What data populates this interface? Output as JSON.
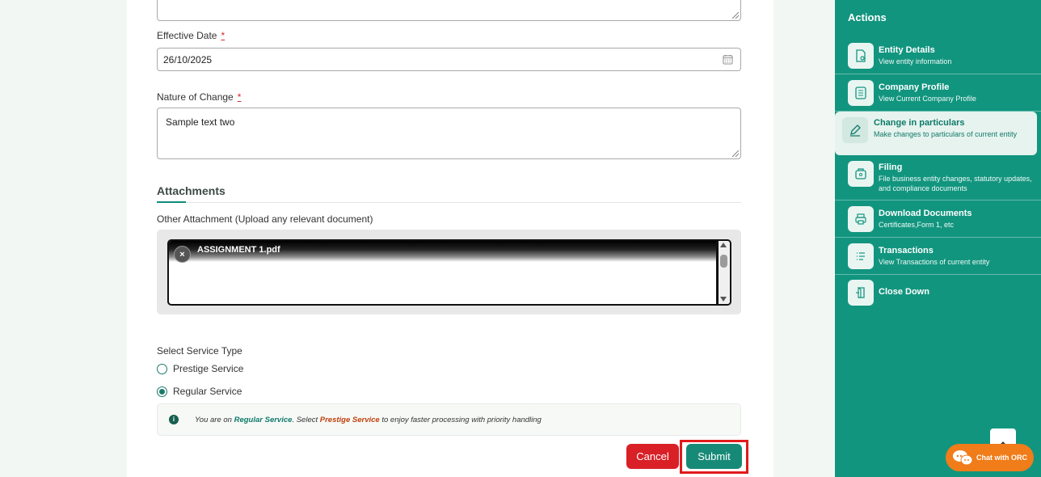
{
  "form": {
    "effective_date": {
      "label": "Effective Date",
      "required_mark": "*",
      "value": "26/10/2025"
    },
    "nature_of_change": {
      "label": "Nature of Change",
      "required_mark": "*",
      "value": "Sample text two"
    },
    "attachments": {
      "section_title": "Attachments",
      "other_label": "Other Attachment (Upload any relevant document)",
      "files": [
        {
          "name": "ASSIGNMENT 1.pdf",
          "remove_glyph": "×"
        }
      ]
    },
    "service": {
      "label": "Select Service Type",
      "options": [
        {
          "label": "Prestige Service",
          "selected": false
        },
        {
          "label": "Regular Service",
          "selected": true
        }
      ],
      "info": {
        "icon": "info-icon",
        "part1": "You are on ",
        "current": "Regular Service",
        "part2": ". Select ",
        "suggest": "Prestige Service",
        "part3": " to enjoy faster processing with priority handling"
      }
    },
    "buttons": {
      "cancel": "Cancel",
      "submit": "Submit"
    }
  },
  "sidebar": {
    "title": "Actions",
    "items": [
      {
        "label": "Entity Details",
        "sub": "View entity information",
        "icon": "document-eye-icon"
      },
      {
        "label": "Company Profile",
        "sub": "View Current Company Profile",
        "icon": "list-icon"
      },
      {
        "label": "Change in particulars",
        "sub": "Make changes to particulars of current entity",
        "icon": "pencil-icon",
        "active": true
      },
      {
        "label": "Filing",
        "sub": "File business entity changes, statutory updates, and compliance documents",
        "icon": "folder-icon"
      },
      {
        "label": "Download Documents",
        "sub": "Certificates,Form 1, etc",
        "icon": "printer-icon"
      },
      {
        "label": "Transactions",
        "sub": "View Transactions of current entity",
        "icon": "transactions-list-icon"
      },
      {
        "label": "Close Down",
        "sub": "",
        "icon": "exit-door-icon"
      }
    ]
  },
  "chat": {
    "label": "Chat with ORC"
  },
  "colors": {
    "accent": "#12957f",
    "danger": "#d92027",
    "chat": "#f07c1a",
    "highlight_outline": "#e01b1b"
  }
}
